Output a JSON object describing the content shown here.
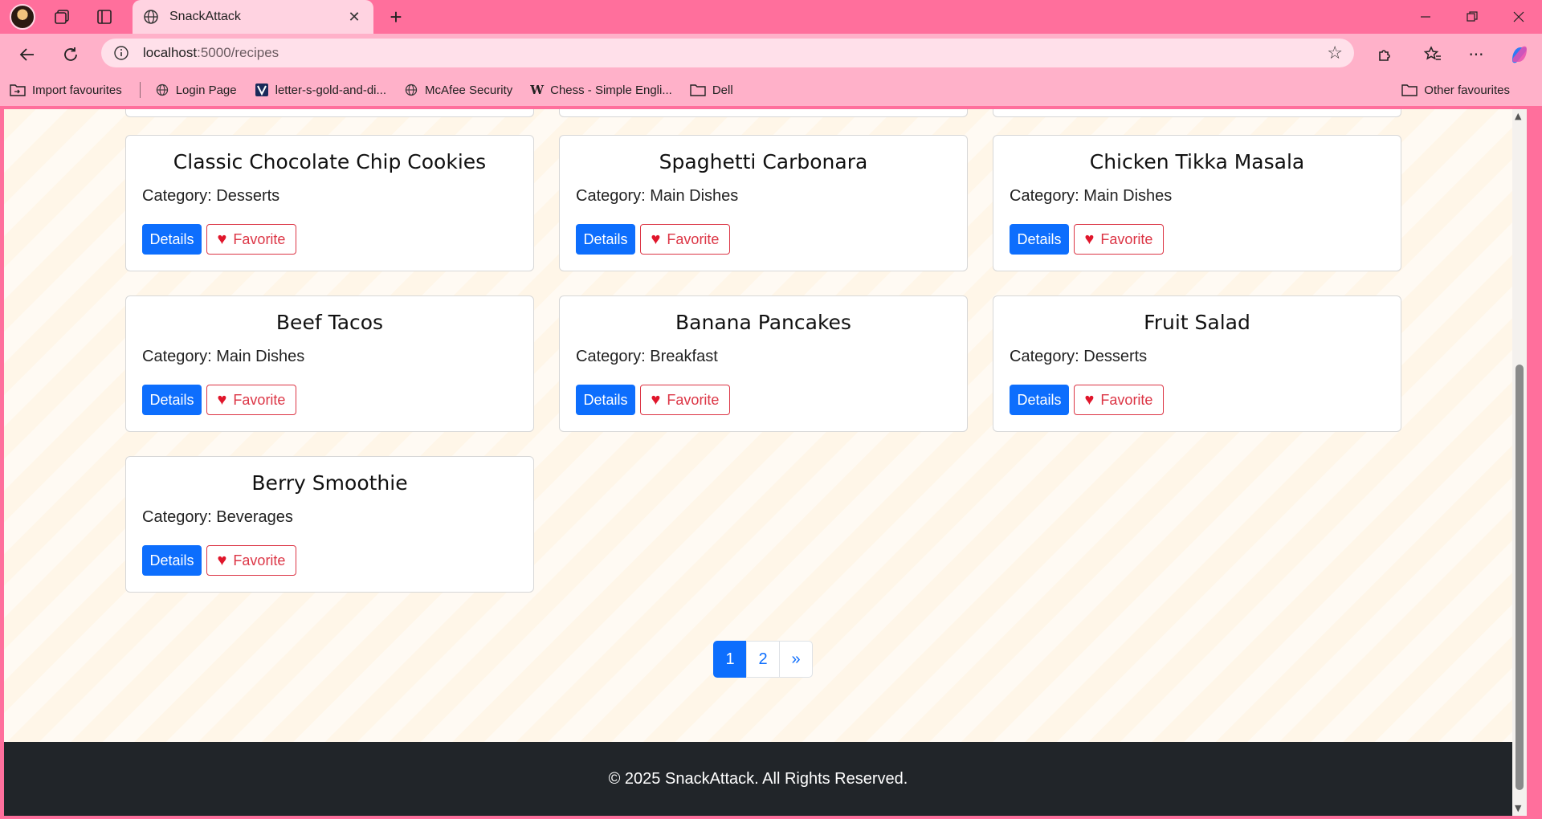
{
  "browser": {
    "tab_title": "SnackAttack",
    "url_host": "localhost",
    "url_path": ":5000/recipes",
    "bookmarks": [
      {
        "label": "Import favourites"
      },
      {
        "label": "Login Page"
      },
      {
        "label": "letter-s-gold-and-di..."
      },
      {
        "label": "McAfee Security"
      },
      {
        "label": "Chess - Simple Engli..."
      },
      {
        "label": "Dell"
      }
    ],
    "other_favourites": "Other favourites"
  },
  "recipes": [
    {
      "name": "Classic Chocolate Chip Cookies",
      "category": "Category: Desserts"
    },
    {
      "name": "Spaghetti Carbonara",
      "category": "Category: Main Dishes"
    },
    {
      "name": "Chicken Tikka Masala",
      "category": "Category: Main Dishes"
    },
    {
      "name": "Beef Tacos",
      "category": "Category: Main Dishes"
    },
    {
      "name": "Banana Pancakes",
      "category": "Category: Breakfast"
    },
    {
      "name": "Fruit Salad",
      "category": "Category: Desserts"
    },
    {
      "name": "Berry Smoothie",
      "category": "Category: Beverages"
    }
  ],
  "buttons": {
    "details": "Details",
    "favorite": "Favorite"
  },
  "pagination": {
    "pages": [
      "1",
      "2"
    ],
    "next": "»",
    "current": "1"
  },
  "footer": {
    "text": "© 2025 SnackAttack. All Rights Reserved."
  },
  "colors": {
    "primary": "#0d6efd",
    "danger": "#dc3545",
    "footer_bg": "#212529",
    "chrome": "#ff6f9c"
  }
}
